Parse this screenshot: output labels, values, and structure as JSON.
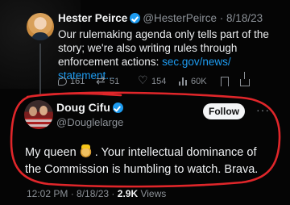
{
  "parent_tweet": {
    "display_name": "Hester Peirce",
    "handle": "@HesterPeirce",
    "date": "8/18/23",
    "text_before_link": "Our rulemaking agenda only tells part of the story; we're also writing rules through enforcement actions: ",
    "link_text": "sec.gov/news/",
    "link_text_2": "statement...",
    "replies": "161",
    "reposts": "51",
    "likes": "154",
    "views": "60K"
  },
  "reply_tweet": {
    "display_name": "Doug Cifu",
    "handle": "@Douglelarge",
    "follow_label": "Follow",
    "text_part1": "My queen ",
    "emoji": "crown-emoji",
    "text_part2": " . Your intellectual dominance of the Commission is humbling to watch.  Brava.",
    "time": "12:02 PM",
    "date": "8/18/23",
    "views_count": "2.9K",
    "views_label": "Views"
  },
  "colors": {
    "accent": "#1d9bf0",
    "annotation_circle": "#e0262a",
    "background": "#050505"
  }
}
